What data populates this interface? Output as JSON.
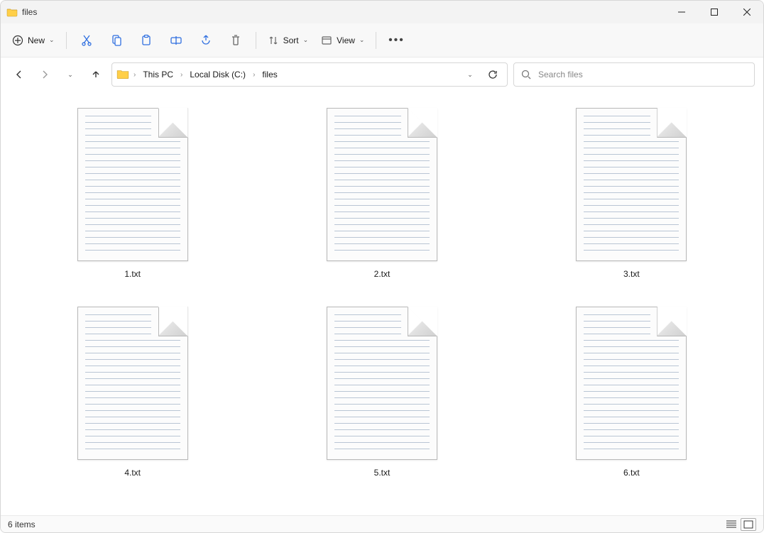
{
  "title": "files",
  "toolbar": {
    "new_label": "New",
    "sort_label": "Sort",
    "view_label": "View"
  },
  "breadcrumbs": [
    "This PC",
    "Local Disk (C:)",
    "files"
  ],
  "search": {
    "placeholder": "Search files"
  },
  "files": [
    {
      "name": "1.txt"
    },
    {
      "name": "2.txt"
    },
    {
      "name": "3.txt"
    },
    {
      "name": "4.txt"
    },
    {
      "name": "5.txt"
    },
    {
      "name": "6.txt"
    }
  ],
  "status": {
    "count_text": "6 items"
  }
}
